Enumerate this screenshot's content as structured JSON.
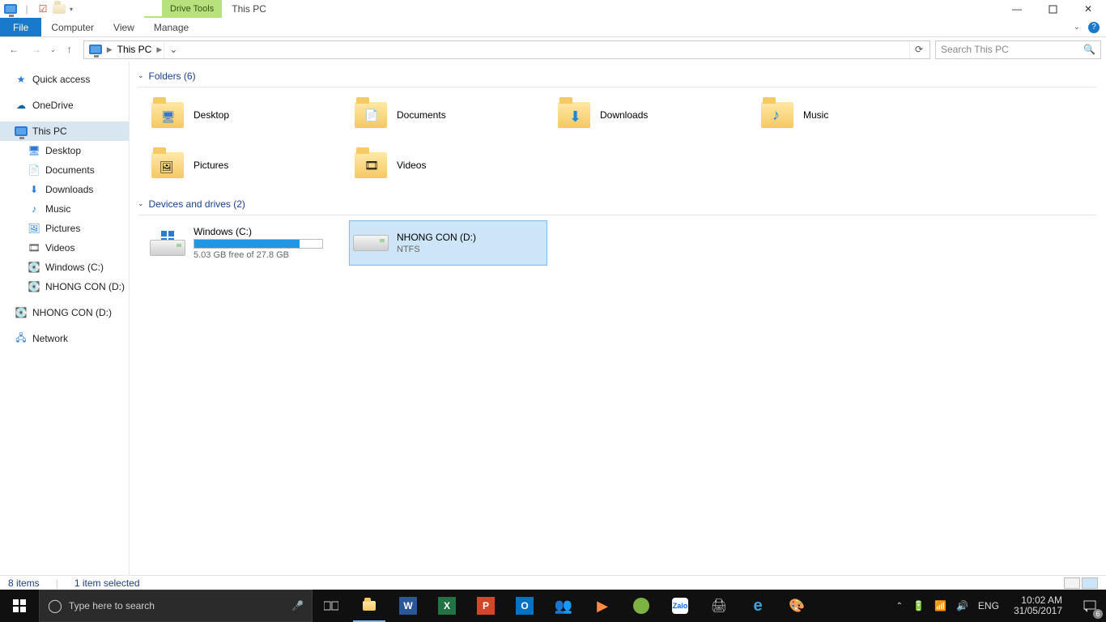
{
  "title": "This PC",
  "contextual_tab": "Drive Tools",
  "ribbon": {
    "tabs": [
      "File",
      "Computer",
      "View",
      "Manage"
    ]
  },
  "address": {
    "current": "This PC",
    "search_placeholder": "Search This PC"
  },
  "sidebar": {
    "quick_access": "Quick access",
    "onedrive": "OneDrive",
    "this_pc": "This PC",
    "children": [
      "Desktop",
      "Documents",
      "Downloads",
      "Music",
      "Pictures",
      "Videos",
      "Windows (C:)",
      "NHONG CON (D:)"
    ],
    "removable": "NHONG CON (D:)",
    "network": "Network"
  },
  "groups": {
    "folders": {
      "label": "Folders (6)",
      "items": [
        "Desktop",
        "Documents",
        "Downloads",
        "Music",
        "Pictures",
        "Videos"
      ]
    },
    "devices": {
      "label": "Devices and drives (2)",
      "c": {
        "name": "Windows (C:)",
        "free": "5.03 GB free of 27.8 GB",
        "fill_pct": 82
      },
      "d": {
        "name": "NHONG CON (D:)",
        "fs": "NTFS"
      }
    }
  },
  "status": {
    "items": "8 items",
    "selected": "1 item selected"
  },
  "taskbar": {
    "search_placeholder": "Type here to search",
    "lang": "ENG",
    "time": "10:02 AM",
    "date": "31/05/2017",
    "notif_count": "6"
  }
}
